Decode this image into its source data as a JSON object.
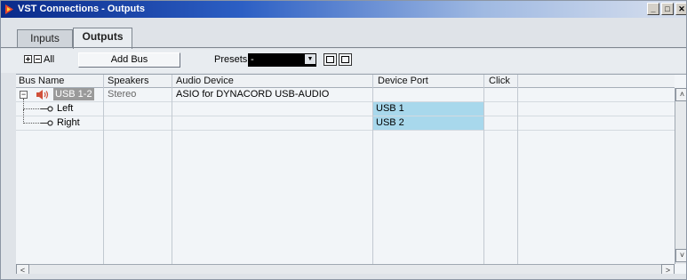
{
  "window": {
    "title": "VST Connections - Outputs",
    "minimize": "_",
    "maximize": "□",
    "close": "✕"
  },
  "tabs": [
    {
      "label": "Inputs",
      "active": false
    },
    {
      "label": "Outputs",
      "active": true
    }
  ],
  "toolbar": {
    "all_label": "All",
    "add_bus": "Add Bus",
    "presets_label": "Presets",
    "presets_value": "-",
    "presets_arrow": "▼"
  },
  "table": {
    "columns": [
      "Bus Name",
      "Speakers",
      "Audio Device",
      "Device Port",
      "Click"
    ],
    "bus": {
      "name": "USB 1-2",
      "speakers": "Stereo",
      "audio_device": "ASIO for DYNACORD USB-AUDIO",
      "expand_symbol": "−"
    },
    "channels": [
      {
        "name": "Left",
        "device_port": "USB 1"
      },
      {
        "name": "Right",
        "device_port": "USB 2"
      }
    ]
  },
  "scrollbar": {
    "up": "˄",
    "down": "˅",
    "left": "<",
    "right": ">"
  },
  "colors": {
    "title_bar_start": "#0a2a8a",
    "port_highlight": "#a8d8ec",
    "bus_selected": "#9a9a9a",
    "speaker_icon": "#d0503a"
  },
  "icons": {
    "title": "vst-logo-icon",
    "bus": "speaker-icon",
    "channel": "channel-connector-icon",
    "expand_all": "expand-all-icon",
    "collapse_all": "collapse-all-icon",
    "save_preset": "save-preset-icon",
    "remove_preset": "remove-preset-icon"
  }
}
